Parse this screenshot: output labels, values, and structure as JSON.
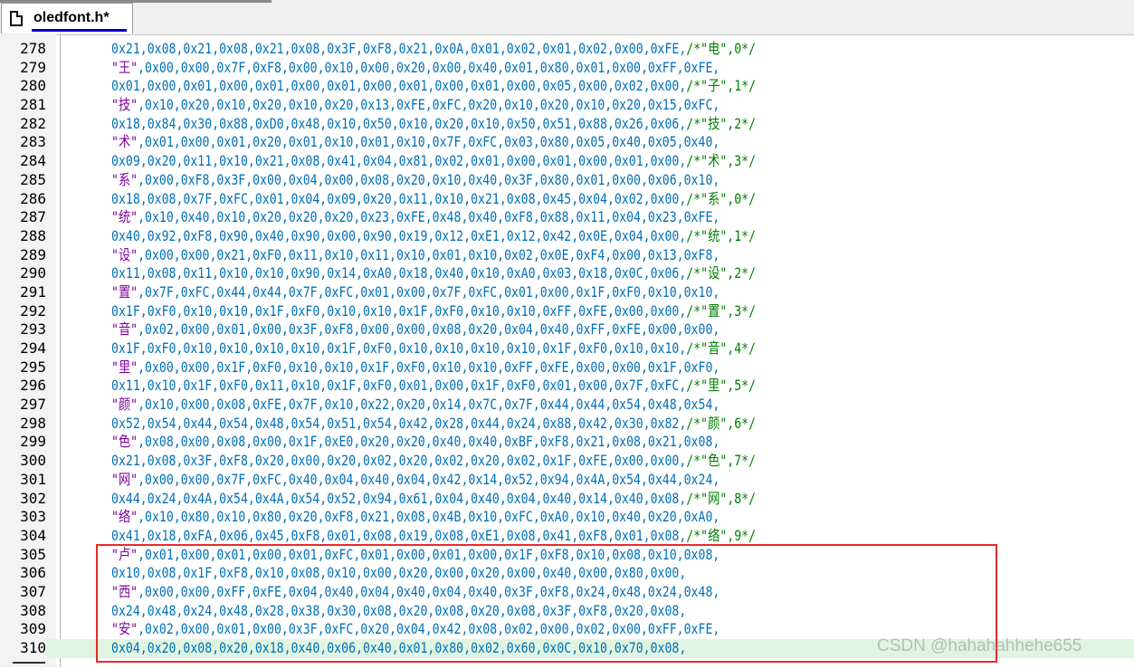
{
  "tab": {
    "label": "oledfont.h*"
  },
  "lines": [
    {
      "n": "278",
      "pre": "0x21,0x08,0x21,0x08,0x21,0x08,0x3F,0xF8,0x21,0x0A,0x01,0x02,0x01,0x02,0x00,0xFE,",
      "comment": "/*\"电\",0*/"
    },
    {
      "n": "279",
      "quote": "\"王\"",
      "pre": ",0x00,0x00,0x7F,0xF8,0x00,0x10,0x00,0x20,0x00,0x40,0x01,0x80,0x01,0x00,0xFF,0xFE,"
    },
    {
      "n": "280",
      "pre": "0x01,0x00,0x01,0x00,0x01,0x00,0x01,0x00,0x01,0x00,0x01,0x00,0x05,0x00,0x02,0x00,",
      "comment": "/*\"子\",1*/"
    },
    {
      "n": "281",
      "quote": "\"技\"",
      "pre": ",0x10,0x20,0x10,0x20,0x10,0x20,0x13,0xFE,0xFC,0x20,0x10,0x20,0x10,0x20,0x15,0xFC,"
    },
    {
      "n": "282",
      "pre": "0x18,0x84,0x30,0x88,0xD0,0x48,0x10,0x50,0x10,0x20,0x10,0x50,0x51,0x88,0x26,0x06,",
      "comment": "/*\"技\",2*/"
    },
    {
      "n": "283",
      "quote": "\"术\"",
      "pre": ",0x01,0x00,0x01,0x20,0x01,0x10,0x01,0x10,0x7F,0xFC,0x03,0x80,0x05,0x40,0x05,0x40,"
    },
    {
      "n": "284",
      "pre": "0x09,0x20,0x11,0x10,0x21,0x08,0x41,0x04,0x81,0x02,0x01,0x00,0x01,0x00,0x01,0x00,",
      "comment": "/*\"术\",3*/"
    },
    {
      "n": "285",
      "quote": "\"系\"",
      "pre": ",0x00,0xF8,0x3F,0x00,0x04,0x00,0x08,0x20,0x10,0x40,0x3F,0x80,0x01,0x00,0x06,0x10,"
    },
    {
      "n": "286",
      "pre": "0x18,0x08,0x7F,0xFC,0x01,0x04,0x09,0x20,0x11,0x10,0x21,0x08,0x45,0x04,0x02,0x00,",
      "comment": "/*\"系\",0*/"
    },
    {
      "n": "287",
      "quote": "\"统\"",
      "pre": ",0x10,0x40,0x10,0x20,0x20,0x20,0x23,0xFE,0x48,0x40,0xF8,0x88,0x11,0x04,0x23,0xFE,"
    },
    {
      "n": "288",
      "pre": "0x40,0x92,0xF8,0x90,0x40,0x90,0x00,0x90,0x19,0x12,0xE1,0x12,0x42,0x0E,0x04,0x00,",
      "comment": "/*\"统\",1*/"
    },
    {
      "n": "289",
      "quote": "\"设\"",
      "pre": ",0x00,0x00,0x21,0xF0,0x11,0x10,0x11,0x10,0x01,0x10,0x02,0x0E,0xF4,0x00,0x13,0xF8,"
    },
    {
      "n": "290",
      "pre": "0x11,0x08,0x11,0x10,0x10,0x90,0x14,0xA0,0x18,0x40,0x10,0xA0,0x03,0x18,0x0C,0x06,",
      "comment": "/*\"设\",2*/"
    },
    {
      "n": "291",
      "quote": "\"置\"",
      "pre": ",0x7F,0xFC,0x44,0x44,0x7F,0xFC,0x01,0x00,0x7F,0xFC,0x01,0x00,0x1F,0xF0,0x10,0x10,"
    },
    {
      "n": "292",
      "pre": "0x1F,0xF0,0x10,0x10,0x1F,0xF0,0x10,0x10,0x1F,0xF0,0x10,0x10,0xFF,0xFE,0x00,0x00,",
      "comment": "/*\"置\",3*/"
    },
    {
      "n": "293",
      "quote": "\"音\"",
      "pre": ",0x02,0x00,0x01,0x00,0x3F,0xF8,0x00,0x00,0x08,0x20,0x04,0x40,0xFF,0xFE,0x00,0x00,"
    },
    {
      "n": "294",
      "pre": "0x1F,0xF0,0x10,0x10,0x10,0x10,0x1F,0xF0,0x10,0x10,0x10,0x10,0x1F,0xF0,0x10,0x10,",
      "comment": "/*\"音\",4*/"
    },
    {
      "n": "295",
      "quote": "\"里\"",
      "pre": ",0x00,0x00,0x1F,0xF0,0x10,0x10,0x1F,0xF0,0x10,0x10,0xFF,0xFE,0x00,0x00,0x1F,0xF0,"
    },
    {
      "n": "296",
      "pre": "0x11,0x10,0x1F,0xF0,0x11,0x10,0x1F,0xF0,0x01,0x00,0x1F,0xF0,0x01,0x00,0x7F,0xFC,",
      "comment": "/*\"里\",5*/"
    },
    {
      "n": "297",
      "quote": "\"颜\"",
      "pre": ",0x10,0x00,0x08,0xFE,0x7F,0x10,0x22,0x20,0x14,0x7C,0x7F,0x44,0x44,0x54,0x48,0x54,"
    },
    {
      "n": "298",
      "pre": "0x52,0x54,0x44,0x54,0x48,0x54,0x51,0x54,0x42,0x28,0x44,0x24,0x88,0x42,0x30,0x82,",
      "comment": "/*\"颜\",6*/"
    },
    {
      "n": "299",
      "quote": "\"色\"",
      "pre": ",0x08,0x00,0x08,0x00,0x1F,0xE0,0x20,0x20,0x40,0x40,0xBF,0xF8,0x21,0x08,0x21,0x08,"
    },
    {
      "n": "300",
      "pre": "0x21,0x08,0x3F,0xF8,0x20,0x00,0x20,0x02,0x20,0x02,0x20,0x02,0x1F,0xFE,0x00,0x00,",
      "comment": "/*\"色\",7*/"
    },
    {
      "n": "301",
      "quote": "\"网\"",
      "pre": ",0x00,0x00,0x7F,0xFC,0x40,0x04,0x40,0x04,0x42,0x14,0x52,0x94,0x4A,0x54,0x44,0x24,"
    },
    {
      "n": "302",
      "pre": "0x44,0x24,0x4A,0x54,0x4A,0x54,0x52,0x94,0x61,0x04,0x40,0x04,0x40,0x14,0x40,0x08,",
      "comment": "/*\"网\",8*/"
    },
    {
      "n": "303",
      "quote": "\"络\"",
      "pre": ",0x10,0x80,0x10,0x80,0x20,0xF8,0x21,0x08,0x4B,0x10,0xFC,0xA0,0x10,0x40,0x20,0xA0,"
    },
    {
      "n": "304",
      "pre": "0x41,0x18,0xFA,0x06,0x45,0xF8,0x01,0x08,0x19,0x08,0xE1,0x08,0x41,0xF8,0x01,0x08,",
      "comment": "/*\"络\",9*/"
    },
    {
      "n": "305",
      "quote": "\"卢\"",
      "pre": ",0x01,0x00,0x01,0x00,0x01,0xFC,0x01,0x00,0x01,0x00,0x1F,0xF8,0x10,0x08,0x10,0x08,"
    },
    {
      "n": "306",
      "pre": "0x10,0x08,0x1F,0xF8,0x10,0x08,0x10,0x00,0x20,0x00,0x20,0x00,0x40,0x00,0x80,0x00,"
    },
    {
      "n": "307",
      "quote": "\"西\"",
      "pre": ",0x00,0x00,0xFF,0xFE,0x04,0x40,0x04,0x40,0x04,0x40,0x3F,0xF8,0x24,0x48,0x24,0x48,"
    },
    {
      "n": "308",
      "pre": "0x24,0x48,0x24,0x48,0x28,0x38,0x30,0x08,0x20,0x08,0x20,0x08,0x3F,0xF8,0x20,0x08,"
    },
    {
      "n": "309",
      "quote": "\"安\"",
      "pre": ",0x02,0x00,0x01,0x00,0x3F,0xFC,0x20,0x04,0x42,0x08,0x02,0x00,0x02,0x00,0xFF,0xFE,"
    },
    {
      "n": "310",
      "pre": "0x04,0x20,0x08,0x20,0x18,0x40,0x06,0x40,0x01,0x80,0x02,0x60,0x0C,0x10,0x70,0x08,",
      "current": true
    }
  ],
  "watermark": "CSDN @hahahahhehe655",
  "colors": {
    "hex": "#0070b8",
    "string": "#8000a0",
    "comment": "#008000",
    "highlight_border": "#e62b2b",
    "current_line": "#dff5e1"
  },
  "icons": {
    "tab_icon": "file-icon"
  }
}
